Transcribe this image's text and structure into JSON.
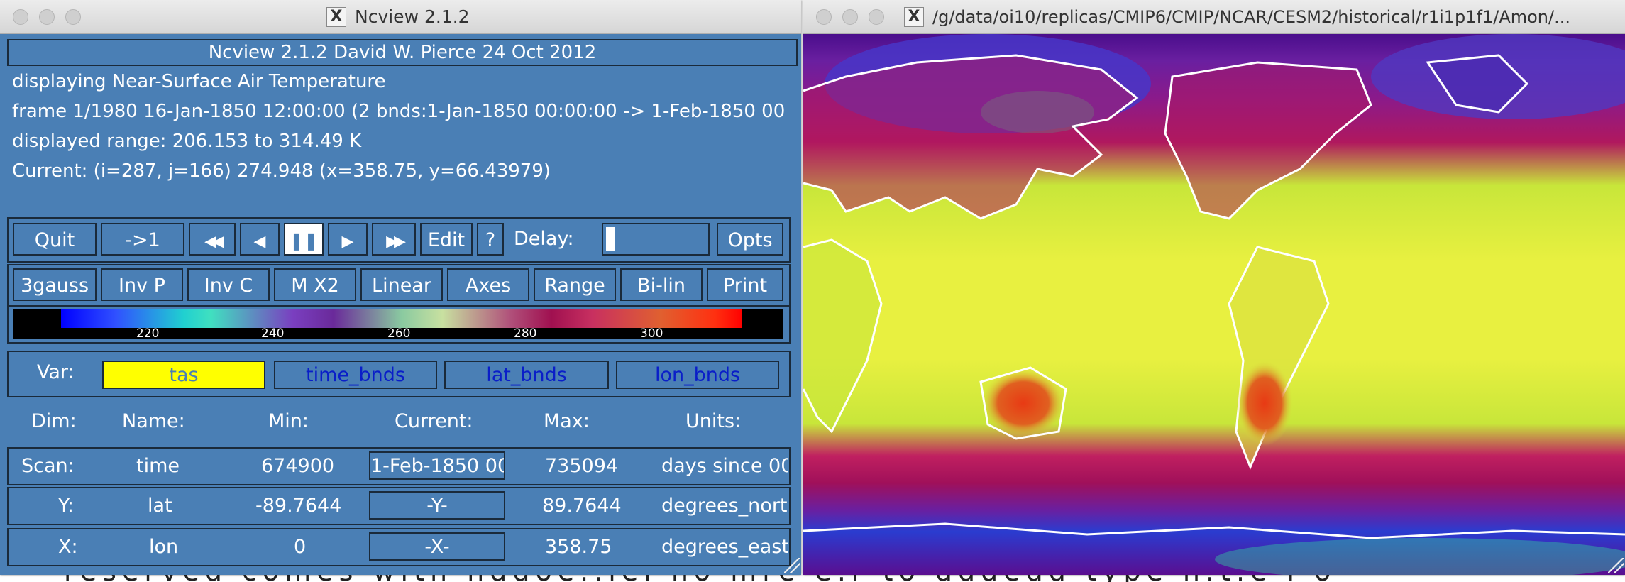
{
  "background": {
    "text": "reserved comes with hddoe..iei  no  mre  e.r  to   dddedd  type  n.t.e  i  o"
  },
  "ncview_window": {
    "title": "Ncview 2.1.2",
    "header": "Ncview 2.1.2 David W. Pierce  24 Oct 2012",
    "info": {
      "displaying": "displaying Near-Surface Air Temperature",
      "frame": "frame 1/1980 16-Jan-1850 12:00:00 (2 bnds:1-Jan-1850 00:00:00 -> 1-Feb-1850 00",
      "range": "displayed range: 206.153 to 314.49 K",
      "current": "Current: (i=287, j=166) 274.948 (x=358.75, y=66.43979)"
    },
    "controls": {
      "quit": "Quit",
      "to_first": "->1",
      "rewind": "◀◀",
      "step_back": "◀",
      "pause": "❚❚",
      "step_forward": "▶",
      "fast_forward": "▶▶",
      "edit": "Edit",
      "help": "?",
      "delay_label": "Delay:",
      "opts": "Opts"
    },
    "options": {
      "gauss": "3gauss",
      "inv_p": "Inv P",
      "inv_c": "Inv C",
      "magnify": "M X2",
      "linear": "Linear",
      "axes": "Axes",
      "range": "Range",
      "bilin": "Bi-lin",
      "print": "Print"
    },
    "colorbar": {
      "ticks": [
        "220",
        "240",
        "260",
        "280",
        "300"
      ]
    },
    "var": {
      "label": "Var:",
      "buttons": [
        "tas",
        "time_bnds",
        "lat_bnds",
        "lon_bnds"
      ],
      "selected": "tas",
      "selected_color": "#ffff00",
      "link_color": "#0a1ec8"
    },
    "dims": {
      "headers": [
        "Dim:",
        "Name:",
        "Min:",
        "Current:",
        "Max:",
        "Units:"
      ],
      "rows": [
        {
          "dim": "Scan:",
          "name": "time",
          "min": "674900",
          "current": "1-Feb-1850 00",
          "max": "735094",
          "units": "days since 00"
        },
        {
          "dim": "Y:",
          "name": "lat",
          "min": "-89.7644",
          "current": "-Y-",
          "max": "89.7644",
          "units": "degrees_nort"
        },
        {
          "dim": "X:",
          "name": "lon",
          "min": "0",
          "current": "-X-",
          "max": "358.75",
          "units": "degrees_east"
        }
      ]
    },
    "panel_color": "#4a7fb5"
  },
  "map_window": {
    "title": "/g/data/oi10/replicas/CMIP6/CMIP/NCAR/CESM2/historical/r1i1p1f1/Amon/..."
  }
}
